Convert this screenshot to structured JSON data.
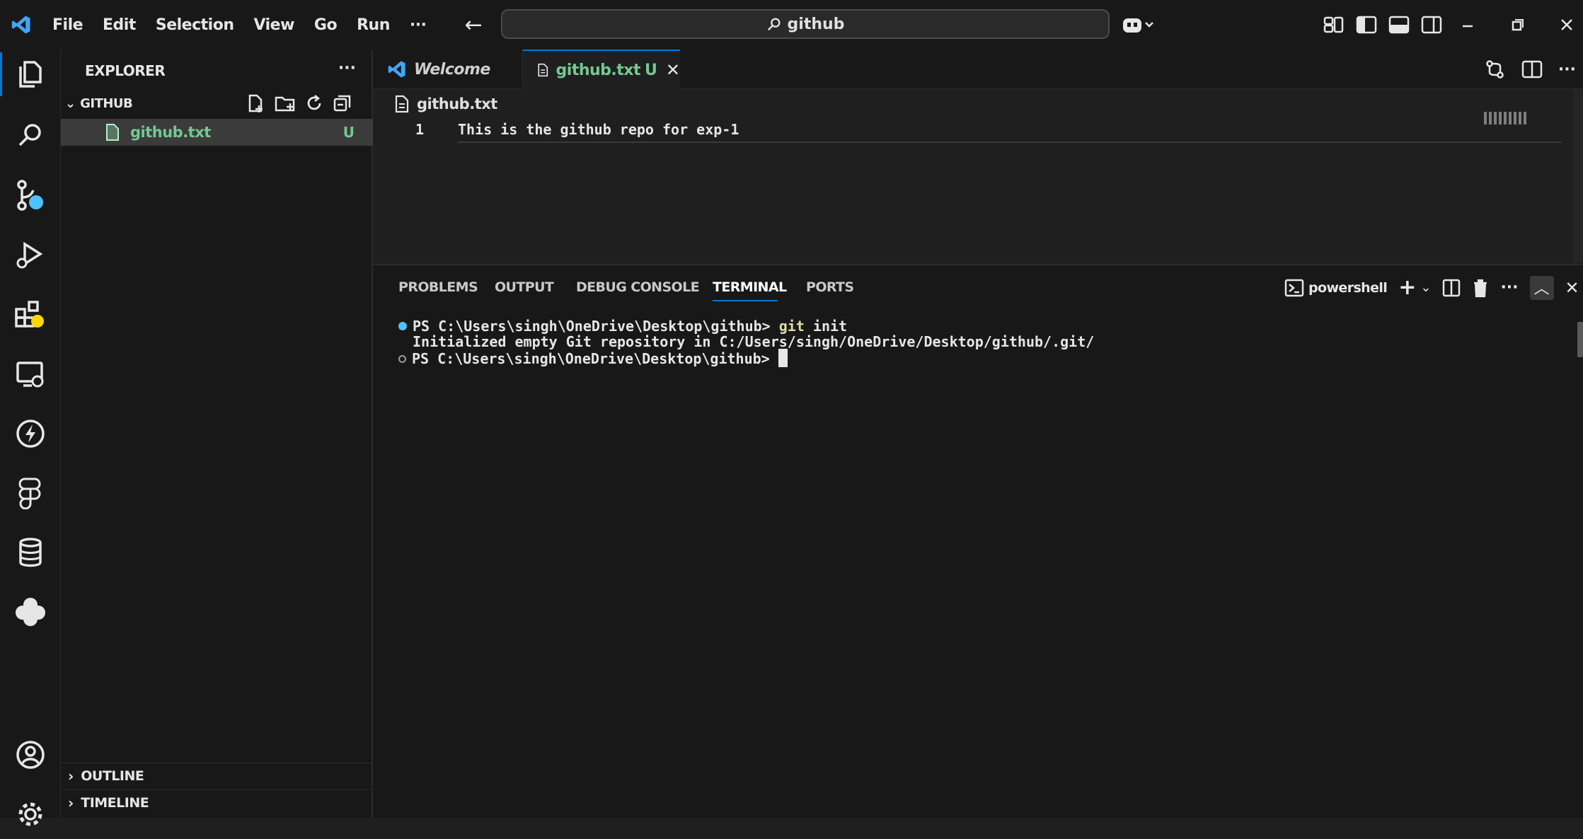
{
  "titlebar": {
    "menu": [
      "File",
      "Edit",
      "Selection",
      "View",
      "Go",
      "Run"
    ],
    "more": "···",
    "search_text": "github",
    "window_controls": [
      "minimize",
      "restore",
      "close"
    ]
  },
  "activity_bar": {
    "items": [
      "explorer",
      "search",
      "source-control",
      "run-and-debug",
      "extensions",
      "remote-explorer",
      "thunder",
      "figma",
      "database",
      "cloud",
      "accounts",
      "manage"
    ]
  },
  "sidebar": {
    "title": "EXPLORER",
    "more": "···",
    "folder": "GITHUB",
    "files": [
      {
        "name": "github.txt",
        "status": "U"
      }
    ],
    "sections": [
      "OUTLINE",
      "TIMELINE"
    ]
  },
  "tabs": [
    {
      "label": "Welcome",
      "active": false,
      "italic": true
    },
    {
      "label": "github.txt",
      "status": "U",
      "active": true
    }
  ],
  "breadcrumb": {
    "file": "github.txt"
  },
  "editor": {
    "lines": [
      {
        "number": "1",
        "text": "This is the github repo for exp-1"
      }
    ]
  },
  "panel": {
    "tabs": [
      "PROBLEMS",
      "OUTPUT",
      "DEBUG CONSOLE",
      "TERMINAL",
      "PORTS"
    ],
    "active_tab": "TERMINAL",
    "shell": "powershell",
    "terminal": {
      "line1_prompt": "PS C:\\Users\\singh\\OneDrive\\Desktop\\github> ",
      "line1_cmd": "git",
      "line1_arg": " init",
      "line2": "Initialized empty Git repository in C:/Users/singh/OneDrive/Desktop/github/.git/",
      "line3_prompt": "PS C:\\Users\\singh\\OneDrive\\Desktop\\github> "
    }
  },
  "colors": {
    "accent": "#0078d4",
    "badge_blue": "#4fc1ff",
    "badge_yellow": "#ffd700",
    "untracked_green": "#73c991",
    "command_yellow": "#dcdcaa"
  }
}
